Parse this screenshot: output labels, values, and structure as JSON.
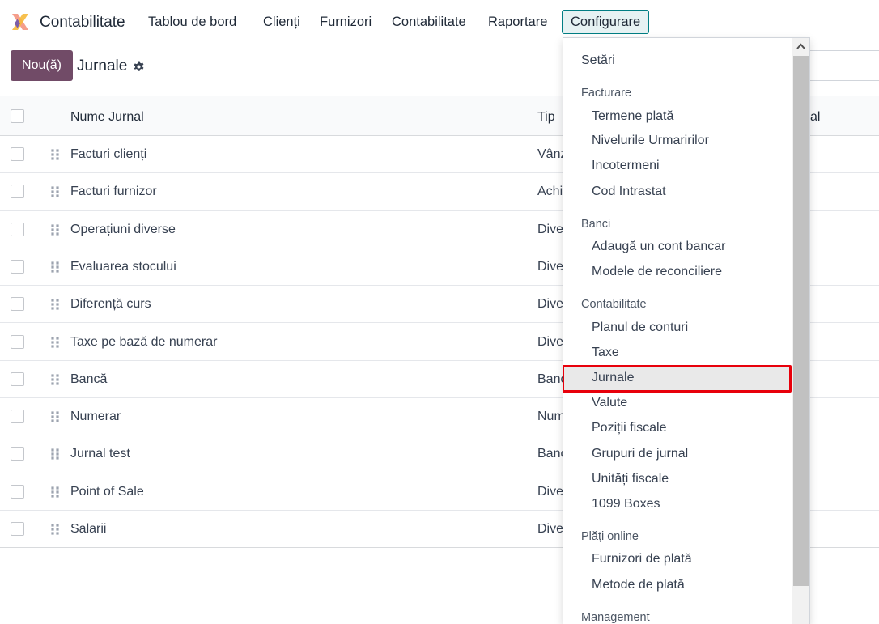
{
  "navbar": {
    "app_name": "Contabilitate",
    "menu": [
      "Tablou de bord",
      "Clienți",
      "Furnizori",
      "Contabilitate",
      "Raportare",
      "Configurare"
    ]
  },
  "control_panel": {
    "new_label": "Nou(ă)",
    "title": "Jurnale"
  },
  "table": {
    "headers": [
      "Nume Jurnal",
      "Tip",
      "al"
    ],
    "rows": [
      {
        "name": "Facturi clienți",
        "type": "Vânz"
      },
      {
        "name": "Facturi furnizor",
        "type": "Achi"
      },
      {
        "name": "Operațiuni diverse",
        "type": "Dive"
      },
      {
        "name": "Evaluarea stocului",
        "type": "Dive"
      },
      {
        "name": "Diferență curs",
        "type": "Dive"
      },
      {
        "name": "Taxe pe bază de numerar",
        "type": "Dive"
      },
      {
        "name": "Bancă",
        "type": "Banc"
      },
      {
        "name": "Numerar",
        "type": "Num"
      },
      {
        "name": "Jurnal test",
        "type": "Banc"
      },
      {
        "name": "Point of Sale",
        "type": "Dive"
      },
      {
        "name": "Salarii",
        "type": "Dive"
      }
    ]
  },
  "dropdown": {
    "settings": "Setări",
    "sections": [
      {
        "header": "Facturare",
        "items": [
          "Termene plată",
          "Nivelurile Urmaririlor",
          "Incotermeni",
          "Cod Intrastat"
        ]
      },
      {
        "header": "Banci",
        "items": [
          "Adaugă un cont bancar",
          "Modele de reconciliere"
        ]
      },
      {
        "header": "Contabilitate",
        "items": [
          "Planul de conturi",
          "Taxe",
          "Jurnale",
          "Valute",
          "Poziții fiscale",
          "Grupuri de jurnal",
          "Unități fiscale",
          "1099 Boxes"
        ]
      },
      {
        "header": "Plăți online",
        "items": [
          "Furnizori de plată",
          "Metode de plată"
        ]
      },
      {
        "header": "Management",
        "items": []
      }
    ]
  },
  "colors": {
    "brand": "#714b67",
    "accent": "#017e84",
    "highlight": "#e8000b"
  }
}
